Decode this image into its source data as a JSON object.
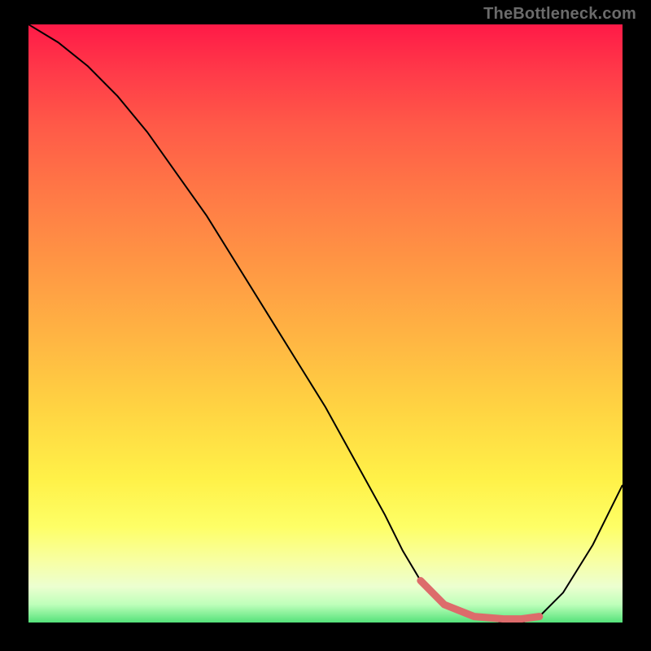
{
  "watermark": "TheBottleneck.com",
  "colors": {
    "background": "#000000",
    "watermark_text": "#6b6b6b",
    "curve": "#000000",
    "flat_zone": "#dd6b6b",
    "gradient_top": "#ff1a47",
    "gradient_bottom": "#55e27a"
  },
  "chart_data": {
    "type": "line",
    "title": "",
    "xlabel": "",
    "ylabel": "",
    "xlim": [
      0,
      100
    ],
    "ylim": [
      0,
      100
    ],
    "grid": false,
    "legend": false,
    "series": [
      {
        "name": "curve",
        "x": [
          0,
          5,
          10,
          15,
          20,
          25,
          30,
          35,
          40,
          45,
          50,
          55,
          60,
          63,
          66,
          70,
          75,
          80,
          83,
          86,
          90,
          95,
          100
        ],
        "y": [
          100,
          97,
          93,
          88,
          82,
          75,
          68,
          60,
          52,
          44,
          36,
          27,
          18,
          12,
          7,
          3,
          1,
          0,
          0,
          1,
          5,
          13,
          23
        ]
      }
    ],
    "annotations": [
      {
        "name": "flat-zone-marker",
        "x_start": 66,
        "x_end": 88,
        "y": 0
      }
    ]
  }
}
